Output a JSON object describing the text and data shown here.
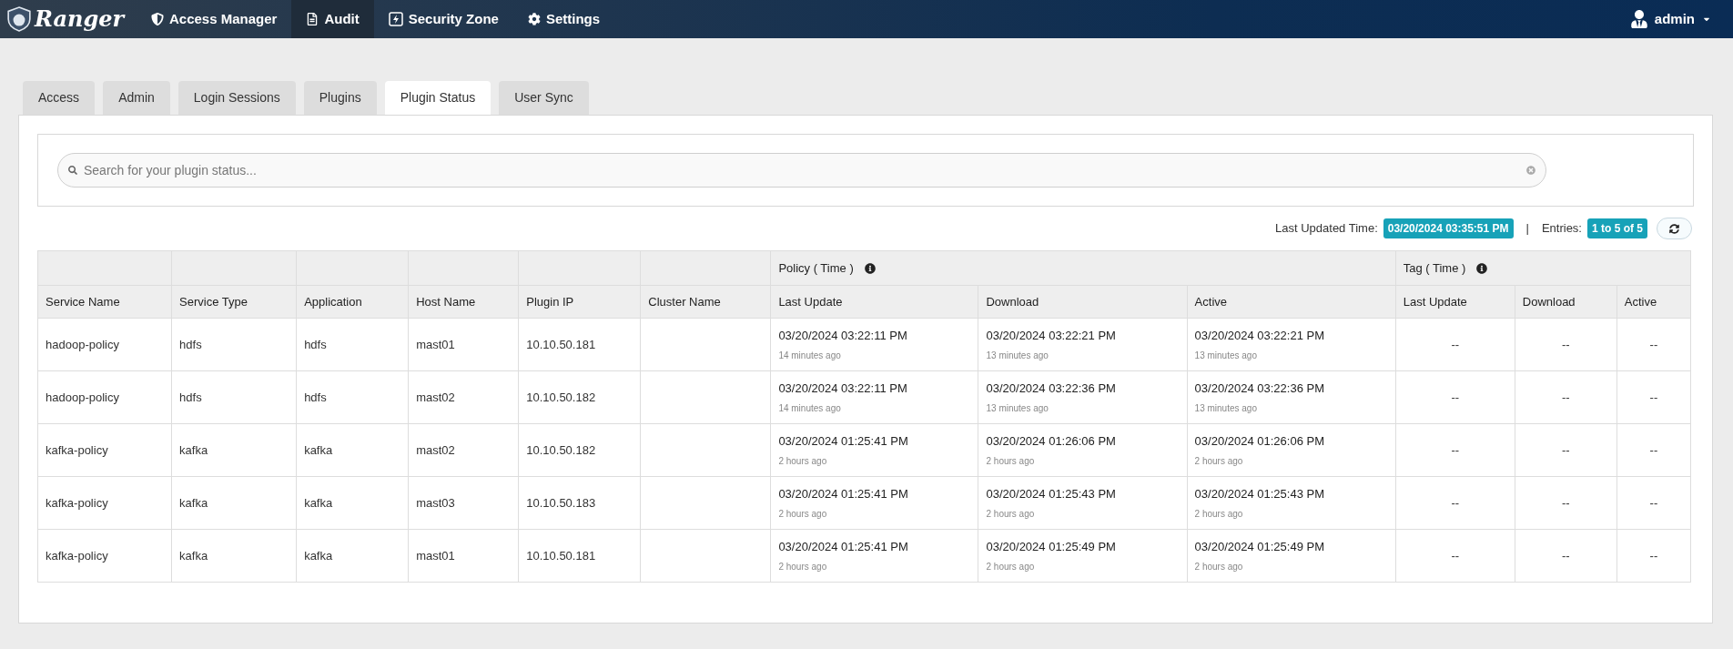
{
  "navbar": {
    "brand": "Ranger",
    "items": [
      {
        "label": "Access Manager",
        "selected": false
      },
      {
        "label": "Audit",
        "selected": true
      },
      {
        "label": "Security Zone",
        "selected": false
      },
      {
        "label": "Settings",
        "selected": false
      }
    ],
    "user": "admin"
  },
  "tabs": [
    {
      "label": "Access",
      "selected": false
    },
    {
      "label": "Admin",
      "selected": false
    },
    {
      "label": "Login Sessions",
      "selected": false
    },
    {
      "label": "Plugins",
      "selected": false
    },
    {
      "label": "Plugin Status",
      "selected": true
    },
    {
      "label": "User Sync",
      "selected": false
    }
  ],
  "search": {
    "placeholder": "Search for your plugin status..."
  },
  "info": {
    "last_updated_label": "Last Updated Time:",
    "last_updated": "03/20/2024 03:35:51 PM",
    "separator": "|",
    "entries_label": "Entries:",
    "entries": "1 to 5 of 5"
  },
  "table": {
    "groups": [
      "Policy ( Time )",
      "Tag ( Time )"
    ],
    "columns": [
      "Service Name",
      "Service Type",
      "Application",
      "Host Name",
      "Plugin IP",
      "Cluster Name",
      "Last Update",
      "Download",
      "Active",
      "Last Update",
      "Download",
      "Active"
    ],
    "rows": [
      {
        "service": "hadoop-policy",
        "type": "hdfs",
        "application": "hdfs",
        "host": "mast01",
        "ip": "10.10.50.181",
        "policy": [
          {
            "time": "03/20/2024 03:22:11 PM",
            "ago": "14 minutes ago"
          },
          {
            "time": "03/20/2024 03:22:21 PM",
            "ago": "13 minutes ago"
          },
          {
            "time": "03/20/2024 03:22:21 PM",
            "ago": "13 minutes ago"
          }
        ],
        "tag": [
          "--",
          "--",
          "--"
        ]
      },
      {
        "service": "hadoop-policy",
        "type": "hdfs",
        "application": "hdfs",
        "host": "mast02",
        "ip": "10.10.50.182",
        "policy": [
          {
            "time": "03/20/2024 03:22:11 PM",
            "ago": "14 minutes ago"
          },
          {
            "time": "03/20/2024 03:22:36 PM",
            "ago": "13 minutes ago"
          },
          {
            "time": "03/20/2024 03:22:36 PM",
            "ago": "13 minutes ago"
          }
        ],
        "tag": [
          "--",
          "--",
          "--"
        ]
      },
      {
        "service": "kafka-policy",
        "type": "kafka",
        "application": "kafka",
        "host": "mast02",
        "ip": "10.10.50.182",
        "policy": [
          {
            "time": "03/20/2024 01:25:41 PM",
            "ago": "2 hours ago"
          },
          {
            "time": "03/20/2024 01:26:06 PM",
            "ago": "2 hours ago"
          },
          {
            "time": "03/20/2024 01:26:06 PM",
            "ago": "2 hours ago"
          }
        ],
        "tag": [
          "--",
          "--",
          "--"
        ]
      },
      {
        "service": "kafka-policy",
        "type": "kafka",
        "application": "kafka",
        "host": "mast03",
        "ip": "10.10.50.183",
        "policy": [
          {
            "time": "03/20/2024 01:25:41 PM",
            "ago": "2 hours ago"
          },
          {
            "time": "03/20/2024 01:25:43 PM",
            "ago": "2 hours ago"
          },
          {
            "time": "03/20/2024 01:25:43 PM",
            "ago": "2 hours ago"
          }
        ],
        "tag": [
          "--",
          "--",
          "--"
        ]
      },
      {
        "service": "kafka-policy",
        "type": "kafka",
        "application": "kafka",
        "host": "mast01",
        "ip": "10.10.50.181",
        "policy": [
          {
            "time": "03/20/2024 01:25:41 PM",
            "ago": "2 hours ago"
          },
          {
            "time": "03/20/2024 01:25:49 PM",
            "ago": "2 hours ago"
          },
          {
            "time": "03/20/2024 01:25:49 PM",
            "ago": "2 hours ago"
          }
        ],
        "tag": [
          "--",
          "--",
          "--"
        ]
      }
    ]
  }
}
